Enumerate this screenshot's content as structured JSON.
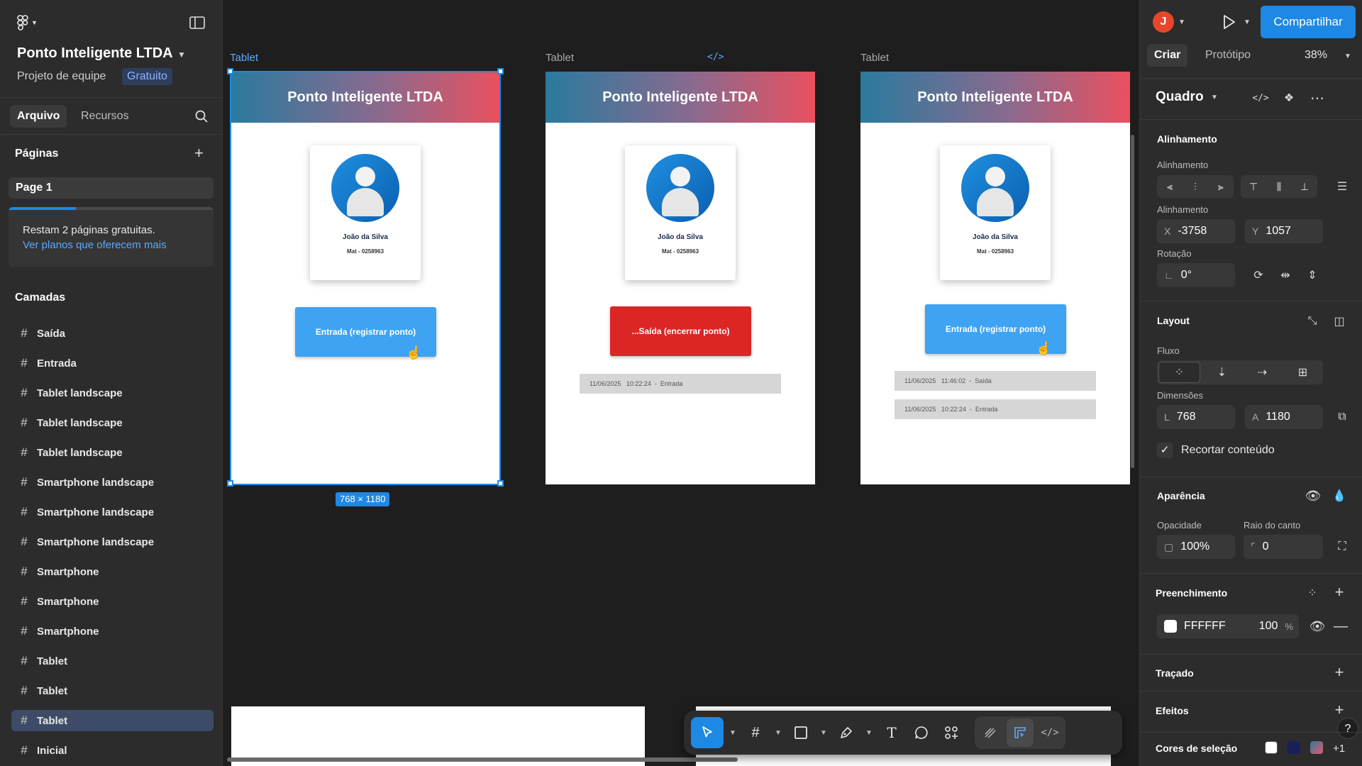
{
  "left_panel": {
    "project_name": "Ponto Inteligente LTDA",
    "project_sub": "Projeto de equipe",
    "plan_badge": "Gratuito",
    "tabs": [
      "Arquivo",
      "Recursos"
    ],
    "pages_title": "Páginas",
    "page_item": "Page 1",
    "upsell_line1": "Restam 2 páginas gratuitas.",
    "upsell_link": "Ver planos que oferecem mais",
    "upsell_progress": 0.33,
    "layers_title": "Camadas",
    "layers": [
      "Saída",
      "Entrada",
      "Tablet landscape",
      "Tablet landscape",
      "Tablet landscape",
      "Smartphone landscape",
      "Smartphone landscape",
      "Smartphone landscape",
      "Smartphone",
      "Smartphone",
      "Smartphone",
      "Tablet",
      "Tablet",
      "Tablet",
      "Inicial"
    ],
    "selected_layer_index": 13
  },
  "canvas": {
    "frame_labels": [
      "Tablet",
      "Tablet",
      "Tablet"
    ],
    "selection_size": "768 × 1180",
    "frames": [
      {
        "header": "Ponto Inteligente LTDA",
        "name": "João da Silva",
        "mat": "Mat - 0258963",
        "button": "Entrada (registrar ponto)",
        "button_color": "#3ea3f3",
        "records": []
      },
      {
        "header": "Ponto Inteligente LTDA",
        "name": "João da Silva",
        "mat": "Mat - 0258963",
        "button": "...Saída (encerrar ponto)",
        "button_color": "#dc2626",
        "records": [
          "11/06/2025   10:22:24  -  Entrada"
        ]
      },
      {
        "header": "Ponto Inteligente LTDA",
        "name": "João da Silva",
        "mat": "Mat - 0258963",
        "button": "Entrada (registrar ponto)",
        "button_color": "#3ea3f3",
        "records": [
          "11/06/2025   11:46:02  -  Saída",
          "11/06/2025   10:22:24  -  Entrada"
        ]
      }
    ]
  },
  "toolbar": {
    "tools": [
      "move-tool",
      "frame-tool",
      "rectangle-tool",
      "pen-tool",
      "text-tool",
      "comment-tool",
      "actions-tool"
    ],
    "mode_tools": [
      "draw-mode",
      "design-mode",
      "dev-mode"
    ],
    "active_tool": "move-tool"
  },
  "right_panel": {
    "user_initial": "J",
    "share": "Compartilhar",
    "tabs": [
      "Criar",
      "Protótipo"
    ],
    "zoom": "38%",
    "selection_type": "Quadro",
    "alignment_title": "Alinhamento",
    "alignment_label": "Alinhamento",
    "position_label": "Alinhamento",
    "x": "-3758",
    "y": "1057",
    "rotation_label": "Rotação",
    "rotation": "0°",
    "layout_title": "Layout",
    "flow_label": "Fluxo",
    "dimensions_label": "Dimensões",
    "width_prefix": "L",
    "width": "768",
    "height_prefix": "A",
    "height": "1180",
    "clip_content": "Recortar conteúdo",
    "appearance_title": "Aparência",
    "opacity_label": "Opacidade",
    "opacity": "100%",
    "radius_label": "Raio do canto",
    "radius": "0",
    "fill_title": "Preenchimento",
    "fill_hex": "FFFFFF",
    "fill_opacity": "100",
    "fill_pct": "%",
    "stroke_title": "Traçado",
    "effects_title": "Efeitos",
    "selection_colors_title": "Cores de seleção",
    "selection_colors": [
      "#ffffff",
      "#1a1f5c",
      "#e85a6a"
    ],
    "selection_colors_more": "+1",
    "help": "?"
  }
}
